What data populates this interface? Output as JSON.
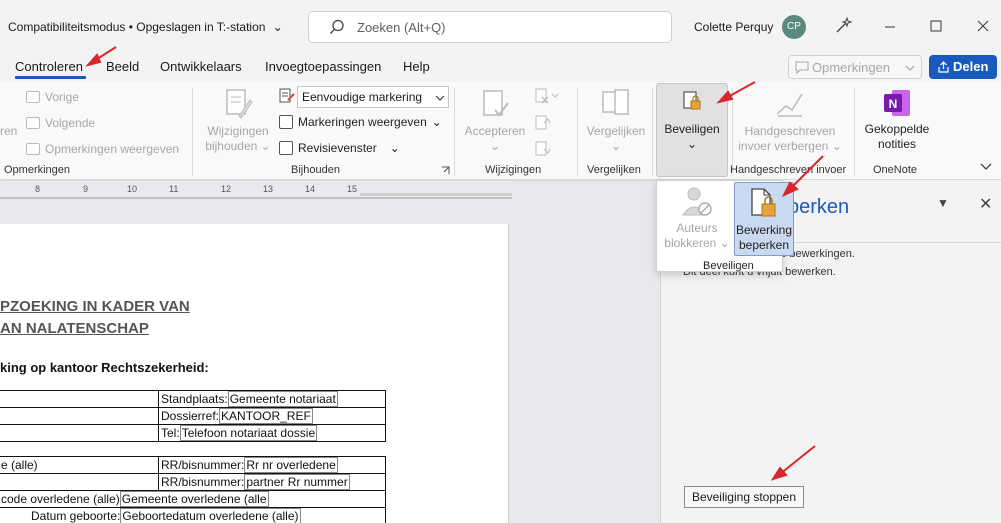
{
  "titlebar": {
    "title": "Compatibiliteitsmodus • Opgeslagen in T:-station",
    "title_caret": "⌄",
    "search_placeholder": "Zoeken (Alt+Q)",
    "user_name": "Colette Perquy",
    "avatar_initials": "CP"
  },
  "tabs": [
    {
      "label": "Controleren",
      "active": true
    },
    {
      "label": "Beeld"
    },
    {
      "label": "Ontwikkelaars"
    },
    {
      "label": "Invoegtoepassingen"
    },
    {
      "label": "Help"
    }
  ],
  "header_buttons": {
    "opmerkingen": "Opmerkingen",
    "delen": "Delen"
  },
  "ribbon": {
    "opmerkingen": {
      "cut_label": "ren",
      "vorige": "Vorige",
      "volgende": "Volgende",
      "weergeven": "Opmerkingen weergeven",
      "group": "Opmerkingen"
    },
    "bijhouden": {
      "btn_line1": "Wijzigingen",
      "btn_line2": "bijhouden",
      "select_value": "Eenvoudige markering",
      "markeringen": "Markeringen weergeven",
      "revisievenster": "Revisievenster",
      "group": "Bijhouden"
    },
    "wijzigingen": {
      "accepteren": "Accepteren",
      "group": "Wijzigingen"
    },
    "vergelijken": {
      "btn": "Vergelijken",
      "group": "Vergelijken"
    },
    "beveiligen": {
      "btn": "Beveiligen"
    },
    "handgeschreven": {
      "line1": "Handgeschreven",
      "line2": "invoer verbergen",
      "group": "Handgeschreven invoer"
    },
    "onenote": {
      "line1": "Gekoppelde",
      "line2": "notities",
      "group": "OneNote"
    }
  },
  "dropdown": {
    "auteurs_line1": "Auteurs",
    "auteurs_line2": "blokkeren",
    "bewerking_line1": "Bewerking",
    "bewerking_line2": "beperken",
    "group": "Beveiligen"
  },
  "ruler": [
    "8",
    "9",
    "10",
    "11",
    "12",
    "13",
    "14",
    "15"
  ],
  "document": {
    "heading1": "PZOEKING IN KADER VAN",
    "heading2": "AN NALATENSCHAP",
    "subheading": "king op kantoor Rechtszekerheid:",
    "table1": [
      {
        "label": "Standplaats:",
        "field": "Gemeente notariaat"
      },
      {
        "label": "Dossierref:",
        "field": "KANTOOR_REF"
      },
      {
        "label": "Tel:",
        "field": "Telefoon notariaat dossie"
      }
    ],
    "table2": {
      "r1_left": "e (alle)",
      "r1_label": "RR/bisnummer:",
      "r1_field": "Rr nr overledene",
      "r2_label": "RR/bisnummer:",
      "r2_field": "partner Rr nummer",
      "r3_text": "code overledene (alle)",
      "r3_field": "Gemeente overledene (alle",
      "r4_label": "Datum geboorte:",
      "r4_field": "Geboortedatum overledene (alle)"
    }
  },
  "pane": {
    "title": "perken",
    "line1": "gd tegen onbedoelde bewerkingen.",
    "line2": "Dit deel kunt u vrijuit bewerken.",
    "stop_button": "Beveiliging stoppen"
  },
  "colors": {
    "accent": "#185abd",
    "arrow": "#d9262c"
  }
}
